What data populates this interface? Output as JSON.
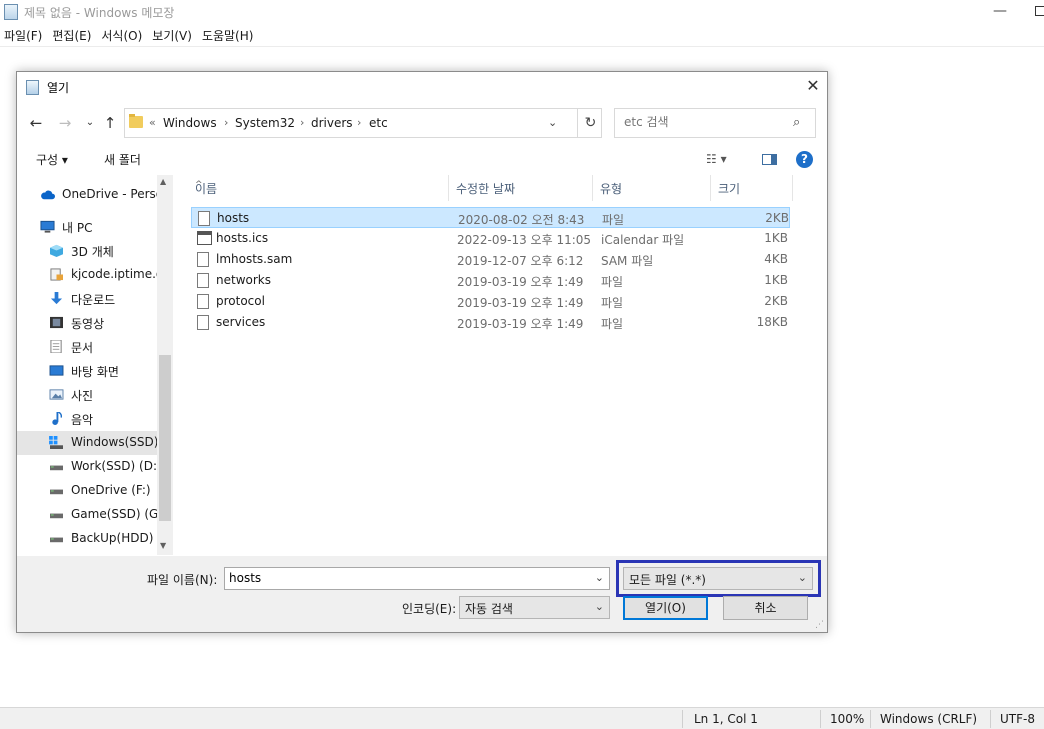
{
  "notepad": {
    "title": "제목 없음 - Windows 메모장",
    "menus": [
      "파일(F)",
      "편집(E)",
      "서식(O)",
      "보기(V)",
      "도움말(H)"
    ],
    "status": {
      "position": "Ln 1, Col 1",
      "zoom": "100%",
      "line_ending": "Windows (CRLF)",
      "encoding": "UTF-8"
    }
  },
  "dialog": {
    "title": "열기",
    "close": "✕",
    "address": {
      "overflow": "«",
      "segments": [
        "Windows",
        "System32",
        "drivers",
        "etc"
      ]
    },
    "search": {
      "placeholder": "etc 검색"
    },
    "toolbar": {
      "organize": "구성",
      "new_folder": "새 폴더"
    },
    "nav_items": [
      {
        "label": "OneDrive - Personal",
        "icon": "cloud-icon"
      },
      {
        "label": "내 PC",
        "icon": "computer-icon"
      },
      {
        "label": "3D 개체",
        "icon": "cube-icon"
      },
      {
        "label": "kjcode.iptime.org",
        "icon": "network-drive-icon"
      },
      {
        "label": "다운로드",
        "icon": "download-icon"
      },
      {
        "label": "동영상",
        "icon": "video-icon"
      },
      {
        "label": "문서",
        "icon": "document-icon"
      },
      {
        "label": "바탕 화면",
        "icon": "desktop-icon"
      },
      {
        "label": "사진",
        "icon": "picture-icon"
      },
      {
        "label": "음악",
        "icon": "music-icon"
      },
      {
        "label": "Windows(SSD) (C:)",
        "icon": "drive-icon",
        "selected": true
      },
      {
        "label": "Work(SSD) (D:)",
        "icon": "drive-icon"
      },
      {
        "label": "OneDrive (F:)",
        "icon": "drive-icon"
      },
      {
        "label": "Game(SSD) (G:)",
        "icon": "drive-icon"
      },
      {
        "label": "BackUp(HDD) (H:)",
        "icon": "drive-icon"
      }
    ],
    "columns": {
      "name": "이름",
      "date": "수정한 날짜",
      "type": "유형",
      "size": "크기"
    },
    "files": [
      {
        "name": "hosts",
        "date": "2020-08-02 오전 8:43",
        "type": "파일",
        "size": "2KB",
        "selected": true,
        "icon": "file-icon"
      },
      {
        "name": "hosts.ics",
        "date": "2022-09-13 오후 11:05",
        "type": "iCalendar 파일",
        "size": "1KB",
        "icon": "calendar-file-icon"
      },
      {
        "name": "lmhosts.sam",
        "date": "2019-12-07 오후 6:12",
        "type": "SAM 파일",
        "size": "4KB",
        "icon": "file-icon"
      },
      {
        "name": "networks",
        "date": "2019-03-19 오후 1:49",
        "type": "파일",
        "size": "1KB",
        "icon": "file-icon"
      },
      {
        "name": "protocol",
        "date": "2019-03-19 오후 1:49",
        "type": "파일",
        "size": "2KB",
        "icon": "file-icon"
      },
      {
        "name": "services",
        "date": "2019-03-19 오후 1:49",
        "type": "파일",
        "size": "18KB",
        "icon": "file-icon"
      }
    ],
    "filename_label": "파일 이름(N):",
    "filename_value": "hosts",
    "filter_value": "모든 파일 (*.*)",
    "encoding_label": "인코딩(E):",
    "encoding_value": "자동 검색",
    "open_button": "열기(O)",
    "cancel_button": "취소",
    "highlight_color": "#2a35b5"
  }
}
